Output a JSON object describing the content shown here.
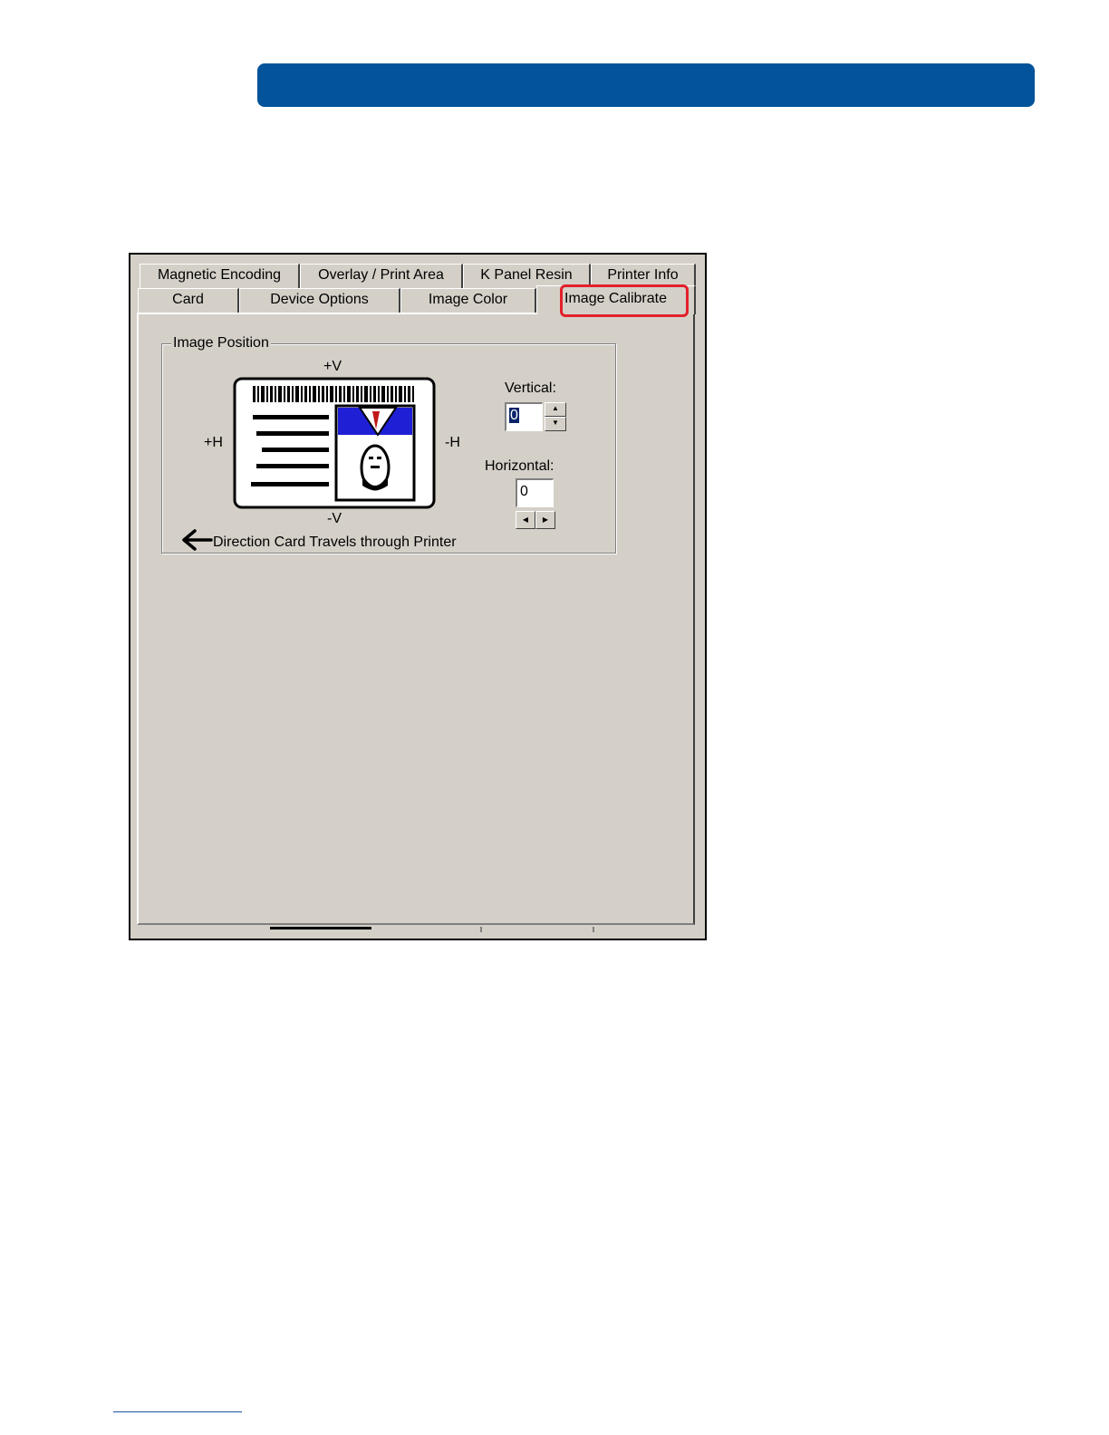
{
  "tabs": {
    "back_row": [
      {
        "label": "Magnetic Encoding"
      },
      {
        "label": "Overlay / Print Area"
      },
      {
        "label": "K Panel Resin"
      },
      {
        "label": "Printer Info"
      }
    ],
    "front_row": [
      {
        "label": "Card"
      },
      {
        "label": "Device Options"
      },
      {
        "label": "Image Color"
      },
      {
        "label": "Image Calibrate",
        "active": true
      }
    ]
  },
  "image_position": {
    "title": "Image Position",
    "plus_v": "+V",
    "minus_v": "-V",
    "plus_h": "+H",
    "minus_h": "-H",
    "direction_text": "Direction Card Travels through Printer",
    "vertical": {
      "label": "Vertical:",
      "value": "0",
      "spin_up": "▲",
      "spin_down": "▼"
    },
    "horizontal": {
      "label": "Horizontal:",
      "value": "0",
      "spin_left": "◀",
      "spin_right": "▶"
    }
  },
  "colors": {
    "header_bar": "#02539a",
    "highlight": "#e3202b",
    "dialog_bg": "#d4d0c8",
    "photo_bg": "#1f1fd6"
  },
  "icons": [
    "left-arrow-icon",
    "id-card-illustration",
    "spin-up-icon",
    "spin-down-icon",
    "spin-left-icon",
    "spin-right-icon"
  ]
}
